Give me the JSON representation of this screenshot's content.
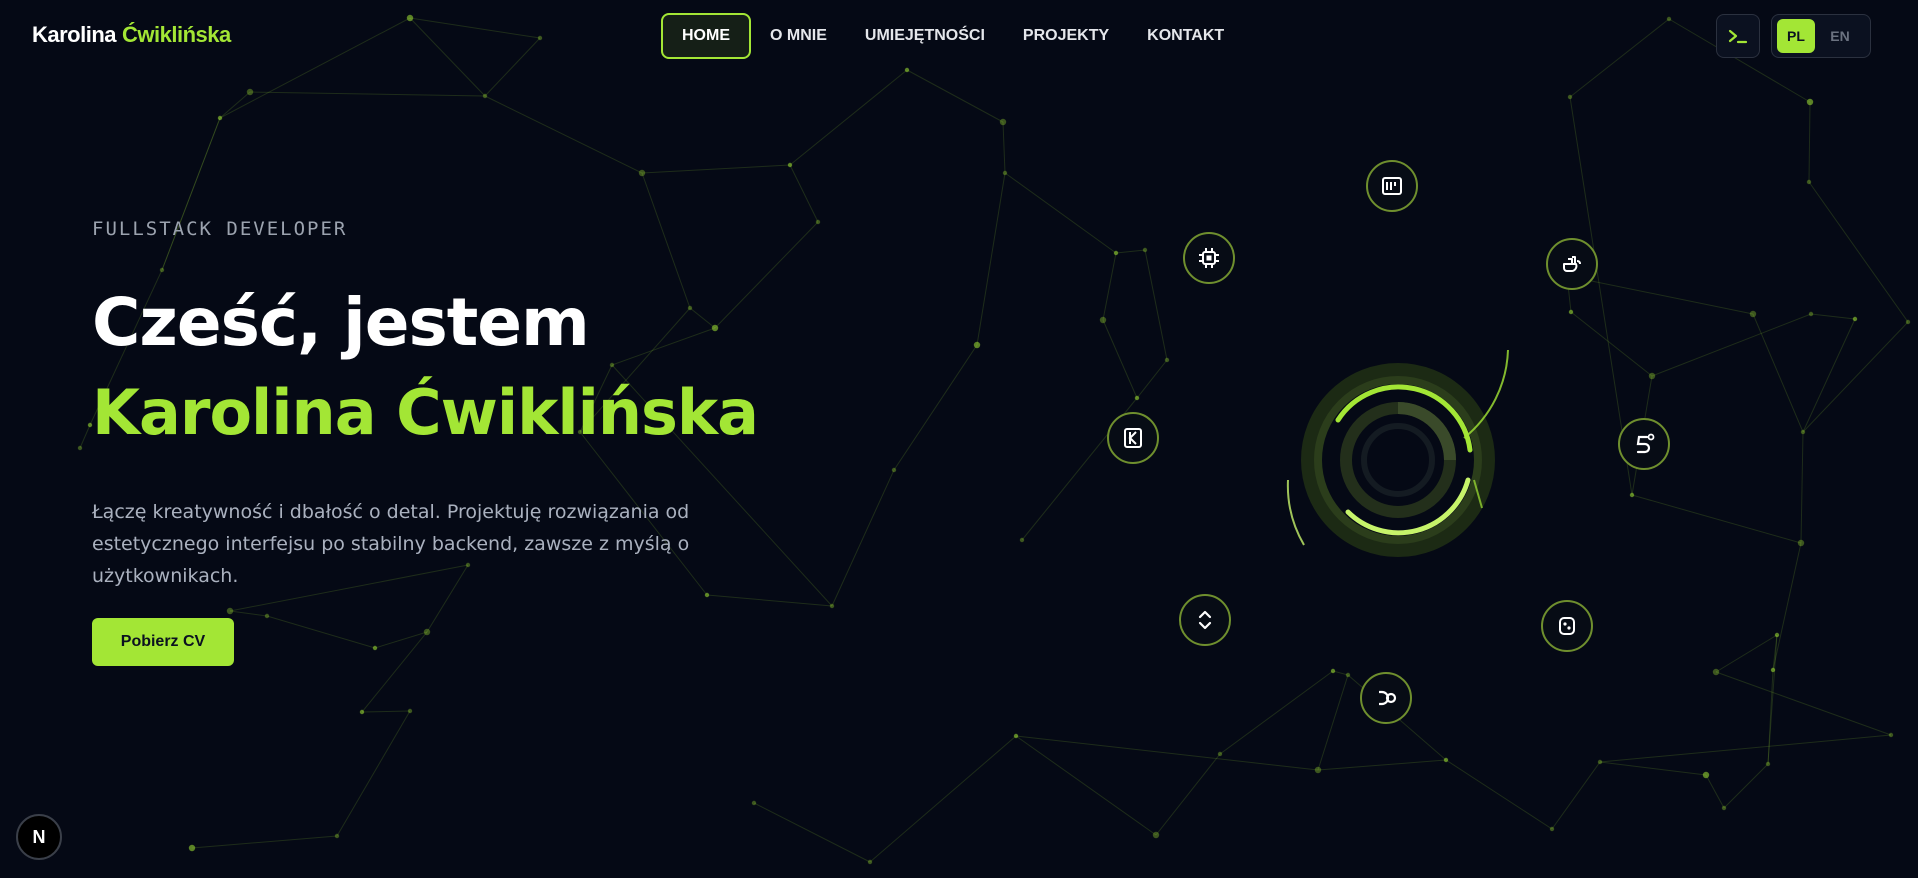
{
  "brand": {
    "first": "Karolina",
    "last": "Ćwiklińska"
  },
  "nav": [
    {
      "label": "HOME",
      "active": true
    },
    {
      "label": "O MNIE",
      "active": false
    },
    {
      "label": "UMIEJĘTNOŚCI",
      "active": false
    },
    {
      "label": "PROJEKTY",
      "active": false
    },
    {
      "label": "KONTAKT",
      "active": false
    }
  ],
  "toolbar": {
    "terminal_icon": "terminal-icon",
    "languages": [
      {
        "label": "PL",
        "active": true
      },
      {
        "label": "EN",
        "active": false
      }
    ]
  },
  "hero": {
    "eyebrow": "FULLSTACK DEVELOPER",
    "greeting": "Cześć, jestem",
    "name": "Karolina Ćwiklińska",
    "description_lines": [
      "Łączę kreatywność i dbałość o detal. Projektuję rozwiązania od",
      "estetycznego interfejsu po stabilny backend, zawsze z myślą o",
      "użytkownikach."
    ],
    "cta_label": "Pobierz CV"
  },
  "tech_icons": [
    "note-icon",
    "chip-icon",
    "docker-icon",
    "kotlin-icon",
    "html5-icon",
    "code-brackets-icon",
    "gamepad-icon",
    "notion-icon"
  ],
  "badge": {
    "label": "N"
  },
  "colors": {
    "accent": "#a3e635",
    "background": "#050915",
    "muted": "#9ca3af"
  }
}
